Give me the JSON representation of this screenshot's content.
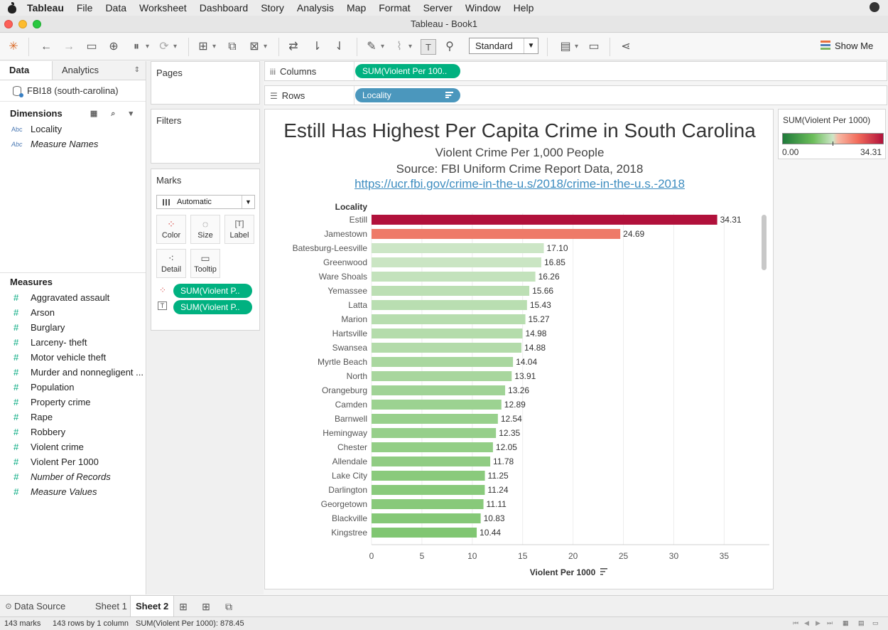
{
  "menubar": {
    "app": "Tableau",
    "items": [
      "File",
      "Data",
      "Worksheet",
      "Dashboard",
      "Story",
      "Analysis",
      "Map",
      "Format",
      "Server",
      "Window",
      "Help"
    ]
  },
  "window": {
    "title": "Tableau - Book1"
  },
  "toolbar": {
    "fit_select": "Standard",
    "show_me": "Show Me"
  },
  "datapane": {
    "tab_data": "Data",
    "tab_analytics": "Analytics",
    "datasource": "FBI18 (south-carolina)",
    "dimensions_header": "Dimensions",
    "dimensions": [
      {
        "type": "Abc",
        "name": "Locality",
        "italic": false
      },
      {
        "type": "Abc",
        "name": "Measure Names",
        "italic": true
      }
    ],
    "measures_header": "Measures",
    "measures": [
      {
        "name": "Aggravated assault",
        "italic": false
      },
      {
        "name": "Arson",
        "italic": false
      },
      {
        "name": "Burglary",
        "italic": false
      },
      {
        "name": "Larceny- theft",
        "italic": false
      },
      {
        "name": "Motor vehicle theft",
        "italic": false
      },
      {
        "name": "Murder and nonnegligent ...",
        "italic": false
      },
      {
        "name": "Population",
        "italic": false
      },
      {
        "name": "Property crime",
        "italic": false
      },
      {
        "name": "Rape",
        "italic": false
      },
      {
        "name": "Robbery",
        "italic": false
      },
      {
        "name": "Violent crime",
        "italic": false
      },
      {
        "name": "Violent Per 1000",
        "italic": false
      },
      {
        "name": "Number of Records",
        "italic": true
      },
      {
        "name": "Measure Values",
        "italic": true
      }
    ]
  },
  "cards": {
    "pages": "Pages",
    "filters": "Filters",
    "marks": "Marks",
    "mark_type": "Automatic",
    "buttons": {
      "color": "Color",
      "size": "Size",
      "label": "Label",
      "detail": "Detail",
      "tooltip": "Tooltip"
    },
    "mark_pills": [
      "SUM(Violent P..",
      "SUM(Violent P.."
    ]
  },
  "shelves": {
    "columns_label": "Columns",
    "columns_pill": "SUM(Violent Per 100..",
    "rows_label": "Rows",
    "rows_pill": "Locality"
  },
  "viz": {
    "title": "Estill Has Highest Per Capita Crime in South Carolina",
    "subtitle1": "Violent Crime Per 1,000 People",
    "subtitle2": "Source: FBI Uniform Crime Report Data, 2018",
    "link": "https://ucr.fbi.gov/crime-in-the-u.s/2018/crime-in-the-u.s.-2018"
  },
  "chart_data": {
    "type": "bar",
    "orientation": "horizontal",
    "row_header": "Locality",
    "xlabel": "Violent Per 1000",
    "xlim": [
      0,
      38.5
    ],
    "xticks": [
      0,
      5,
      10,
      15,
      20,
      25,
      30,
      35
    ],
    "categories": [
      "Estill",
      "Jamestown",
      "Batesburg-Leesville",
      "Greenwood",
      "Ware Shoals",
      "Yemassee",
      "Latta",
      "Marion",
      "Hartsville",
      "Swansea",
      "Myrtle Beach",
      "North",
      "Orangeburg",
      "Camden",
      "Barnwell",
      "Hemingway",
      "Chester",
      "Allendale",
      "Lake City",
      "Darlington",
      "Georgetown",
      "Blackville",
      "Kingstree"
    ],
    "values": [
      34.31,
      24.69,
      17.1,
      16.85,
      16.26,
      15.66,
      15.43,
      15.27,
      14.98,
      14.88,
      14.04,
      13.91,
      13.26,
      12.89,
      12.54,
      12.35,
      12.05,
      11.78,
      11.25,
      11.24,
      11.11,
      10.83,
      10.44
    ],
    "labels": [
      "34.31",
      "24.69",
      "17.10",
      "16.85",
      "16.26",
      "15.66",
      "15.43",
      "15.27",
      "14.98",
      "14.88",
      "14.04",
      "13.91",
      "13.26",
      "12.89",
      "12.54",
      "12.35",
      "12.05",
      "11.78",
      "11.25",
      "11.24",
      "11.11",
      "10.83",
      "10.44"
    ],
    "color_scale": {
      "min": 0.0,
      "max": 34.31,
      "colors": [
        "#1f7a3a",
        "#6bbd5a",
        "#cde6c7",
        "#f26b5b",
        "#b1113b"
      ]
    },
    "grid": true
  },
  "legend": {
    "title": "SUM(Violent Per 1000)",
    "min_label": "0.00",
    "max_label": "34.31"
  },
  "sheettabs": {
    "datasource": "Data Source",
    "sheet1": "Sheet 1",
    "sheet2": "Sheet 2"
  },
  "status": {
    "marks": "143 marks",
    "rows": "143 rows by 1 column",
    "sum": "SUM(Violent Per 1000): 878.45"
  }
}
